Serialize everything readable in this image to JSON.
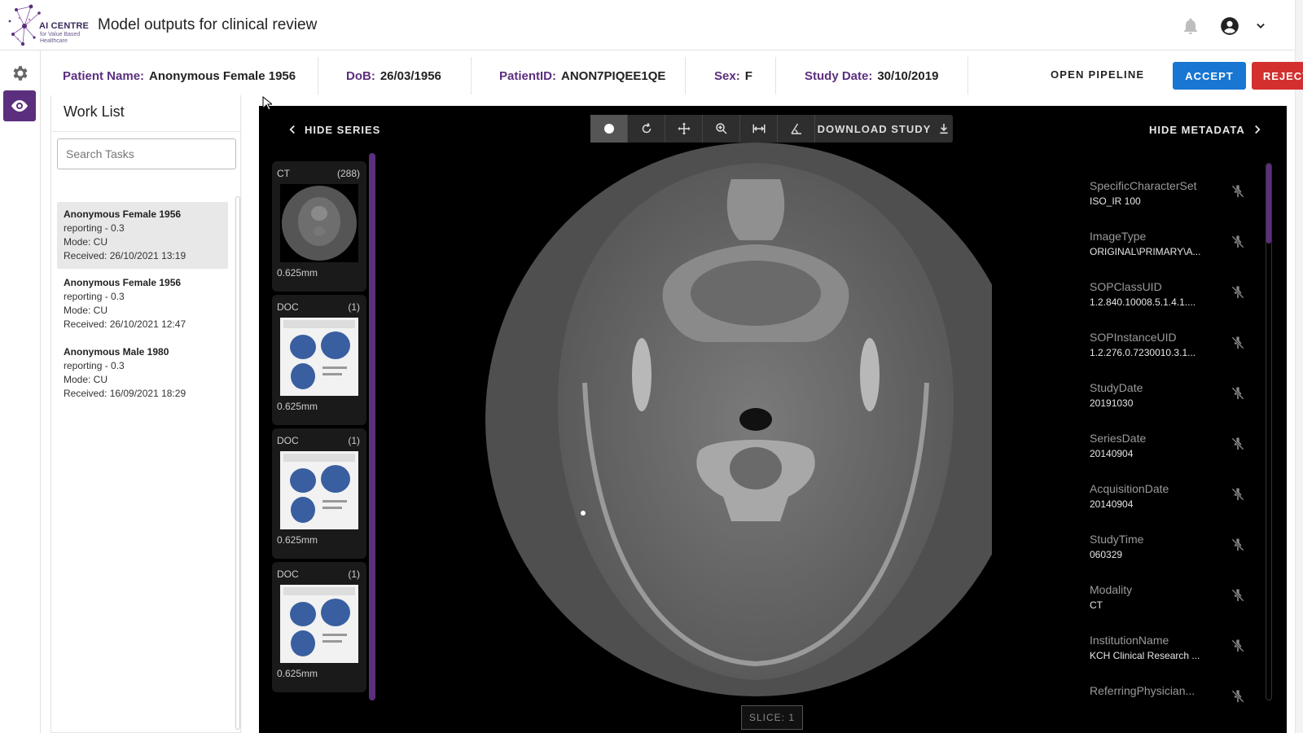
{
  "app": {
    "logo_title": "AI CENTRE",
    "logo_subtitle": "for Value Based Healthcare",
    "title": "Model outputs for clinical review"
  },
  "patient": {
    "name_label": "Patient Name:",
    "name": "Anonymous Female 1956",
    "dob_label": "DoB:",
    "dob": "26/03/1956",
    "id_label": "PatientID:",
    "id": "ANON7PIQEE1QE",
    "sex_label": "Sex:",
    "sex": "F",
    "study_date_label": "Study Date:",
    "study_date": "30/10/2019"
  },
  "actions": {
    "open_pipeline": "OPEN PIPELINE",
    "accept": "ACCEPT",
    "reject": "REJECT"
  },
  "worklist": {
    "title": "Work List",
    "search_placeholder": "Search Tasks",
    "tasks": [
      {
        "name": "Anonymous Female 1956",
        "status": "reporting - 0.3",
        "mode": "Mode: CU",
        "received": "Received: 26/10/2021 13:19"
      },
      {
        "name": "Anonymous Female 1956",
        "status": "reporting - 0.3",
        "mode": "Mode: CU",
        "received": "Received: 26/10/2021 12:47"
      },
      {
        "name": "Anonymous Male 1980",
        "status": "reporting - 0.3",
        "mode": "Mode: CU",
        "received": "Received: 16/09/2021 18:29"
      }
    ]
  },
  "viewer": {
    "hide_series": "HIDE SERIES",
    "hide_metadata": "HIDE METADATA",
    "download_study": "DOWNLOAD STUDY",
    "slice": "SLICE: 1",
    "series": [
      {
        "modality": "CT",
        "count": "(288)",
        "thickness": "0.625mm"
      },
      {
        "modality": "DOC",
        "count": "(1)",
        "thickness": "0.625mm"
      },
      {
        "modality": "DOC",
        "count": "(1)",
        "thickness": "0.625mm"
      },
      {
        "modality": "DOC",
        "count": "(1)",
        "thickness": "0.625mm"
      }
    ],
    "metadata": [
      {
        "key": "SpecificCharacterSet",
        "value": "ISO_IR 100"
      },
      {
        "key": "ImageType",
        "value": "ORIGINAL\\PRIMARY\\A..."
      },
      {
        "key": "SOPClassUID",
        "value": "1.2.840.10008.5.1.4.1...."
      },
      {
        "key": "SOPInstanceUID",
        "value": "1.2.276.0.7230010.3.1..."
      },
      {
        "key": "StudyDate",
        "value": "20191030"
      },
      {
        "key": "SeriesDate",
        "value": "20140904"
      },
      {
        "key": "AcquisitionDate",
        "value": "20140904"
      },
      {
        "key": "StudyTime",
        "value": "060329"
      },
      {
        "key": "Modality",
        "value": "CT"
      },
      {
        "key": "InstitutionName",
        "value": "KCH Clinical Research ..."
      },
      {
        "key": "ReferringPhysician...",
        "value": ""
      }
    ]
  },
  "colors": {
    "brand_purple": "#5b2f7e",
    "accept_blue": "#1976d2",
    "reject_red": "#d32f2f"
  }
}
